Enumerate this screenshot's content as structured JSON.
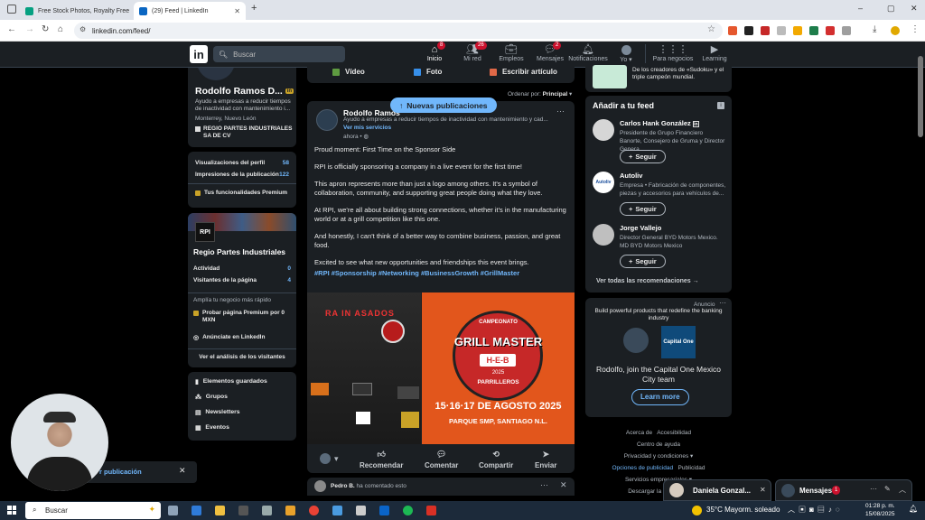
{
  "browser": {
    "tabs": [
      {
        "title": "Free Stock Photos, Royalty Free"
      },
      {
        "title": "(29) Feed | LinkedIn"
      }
    ],
    "new_tab": "+",
    "url": "linkedin.com/feed/",
    "window_controls": [
      "–",
      "▢",
      "✕"
    ]
  },
  "header": {
    "search_placeholder": "Buscar",
    "nav": [
      {
        "label": "Inicio",
        "badge": "8",
        "icon": "home-icon"
      },
      {
        "label": "Mi red",
        "badge": "26",
        "icon": "network-icon"
      },
      {
        "label": "Empleos",
        "badge": "",
        "icon": "briefcase-icon"
      },
      {
        "label": "Mensajes",
        "badge": "2",
        "icon": "chat-icon"
      },
      {
        "label": "Notificaciones",
        "badge": "",
        "icon": "bell-icon"
      },
      {
        "label": "Yo",
        "badge": "",
        "icon": "avatar-icon"
      },
      {
        "label": "Para negocios",
        "badge": "",
        "icon": "grid-icon"
      },
      {
        "label": "Learning",
        "badge": "",
        "icon": "play-icon"
      }
    ]
  },
  "profile": {
    "name": "Rodolfo Ramos D...",
    "headline": "Ayudo a empresas a reducir tiempos de inactividad con mantenimiento i...",
    "location": "Monterrey, Nuevo León",
    "company": "REGIO PARTES INDUSTRIALES SA DE CV",
    "stats": [
      {
        "label": "Visualizaciones del perfil",
        "value": "58"
      },
      {
        "label": "Impresiones de la publicación",
        "value": "122"
      }
    ],
    "premium": "Tus funcionalidades Premium"
  },
  "page_card": {
    "logo_text": "RPI",
    "name": "Regio Partes Industriales",
    "rows": [
      {
        "label": "Actividad",
        "value": "0"
      },
      {
        "label": "Visitantes de la página",
        "value": "4"
      }
    ],
    "grow_text": "Amplía tu negocio más rápido",
    "premium_trial": "Probar página Premium por 0 MXN",
    "advertise": "Anúnciate en LinkedIn",
    "analytics": "Ver el análisis de los visitantes"
  },
  "left_links": [
    "Elementos guardados",
    "Grupos",
    "Newsletters",
    "Eventos"
  ],
  "composer": {
    "video": "Vídeo",
    "photo": "Foto",
    "article": "Escribir artículo"
  },
  "sort": {
    "label": "Ordenar por:",
    "value": "Principal"
  },
  "new_posts_pill": "Nuevas publicaciones",
  "post": {
    "author": "Rodolfo Ramos",
    "headline": "Ayudo a empresas a reducir tiempos de inactividad con mantenimiento y cad...",
    "services": "Ver mis servicios",
    "time": "ahora •",
    "paragraphs": [
      "Proud moment: First Time on the Sponsor Side",
      "RPI is officially sponsoring a company in a live event for the first time!",
      "This apron represents more than just a logo among others. It's a symbol of collaboration, community, and supporting great people doing what they love.",
      "At RPI, we're all about building strong connections, whether it's in the manufacturing world or at a grill competition like this one.",
      "And honestly, I can't think of a better way to combine business, passion, and great food.",
      "Excited to see what new opportunities and friendships this event brings."
    ],
    "hashtags": "#RPI #Sponsorship #Networking #BusinessGrowth #GrillMaster",
    "image_right": {
      "top": "CAMPEONATO",
      "line1": "GRILL MASTER",
      "brand": "H-E-B",
      "year": "2025",
      "bottom": "PARRILLEROS",
      "dates": "15·16·17 DE AGOSTO 2025",
      "place": "PARQUE SMP, SANTIAGO N.L."
    },
    "apron_text": "RA IN ASADOS",
    "actions": [
      "Recomendar",
      "Comentar",
      "Compartir",
      "Enviar"
    ]
  },
  "comment_bar": {
    "name": "Pedro B.",
    "text": "ha comentado esto"
  },
  "right": {
    "top_promo": "De los creadores de «Sudoku» y el triple campeón mundial.",
    "feed_title": "Añadir a tu feed",
    "suggestions": [
      {
        "name": "Carlos Hank González",
        "desc": "Presidente de Grupo Financiero Banorte, Consejero de Gruma y Director Genera..."
      },
      {
        "name": "Autoliv",
        "desc": "Empresa • Fabricación de componentes, piezas y accesorios para vehículos de..."
      },
      {
        "name": "Jorge Vallejo",
        "desc": "Director General BYD Motors Mexico. MD BYD Motors Mexico"
      }
    ],
    "follow": "Seguir",
    "see_all": "Ver todas las recomendaciones →",
    "ad_label": "Anuncio",
    "ad_title": "Build powerful products that redefine the banking industry",
    "ad_body": "Rodolfo, join the Capital One Mexico City team",
    "ad_cta": "Learn more",
    "ad_logo": "Capital One"
  },
  "footer_links": [
    "Acerca de",
    "Accesibilidad",
    "Centro de ayuda",
    "Privacidad y condiciones ▾",
    "Opciones de publicidad",
    "Publicidad",
    "Servicios empresariales ▾",
    "Descargar la aplicación"
  ],
  "messaging": {
    "label": "Mensajes",
    "count": "1"
  },
  "chat_popup": {
    "name": "Daniela Gonzal..."
  },
  "toast_text": "r publicación",
  "taskbar": {
    "search": "Buscar",
    "weather": "35°C  Mayorm. soleado",
    "time": "01:28 p. m.",
    "date": "15/08/2025"
  }
}
